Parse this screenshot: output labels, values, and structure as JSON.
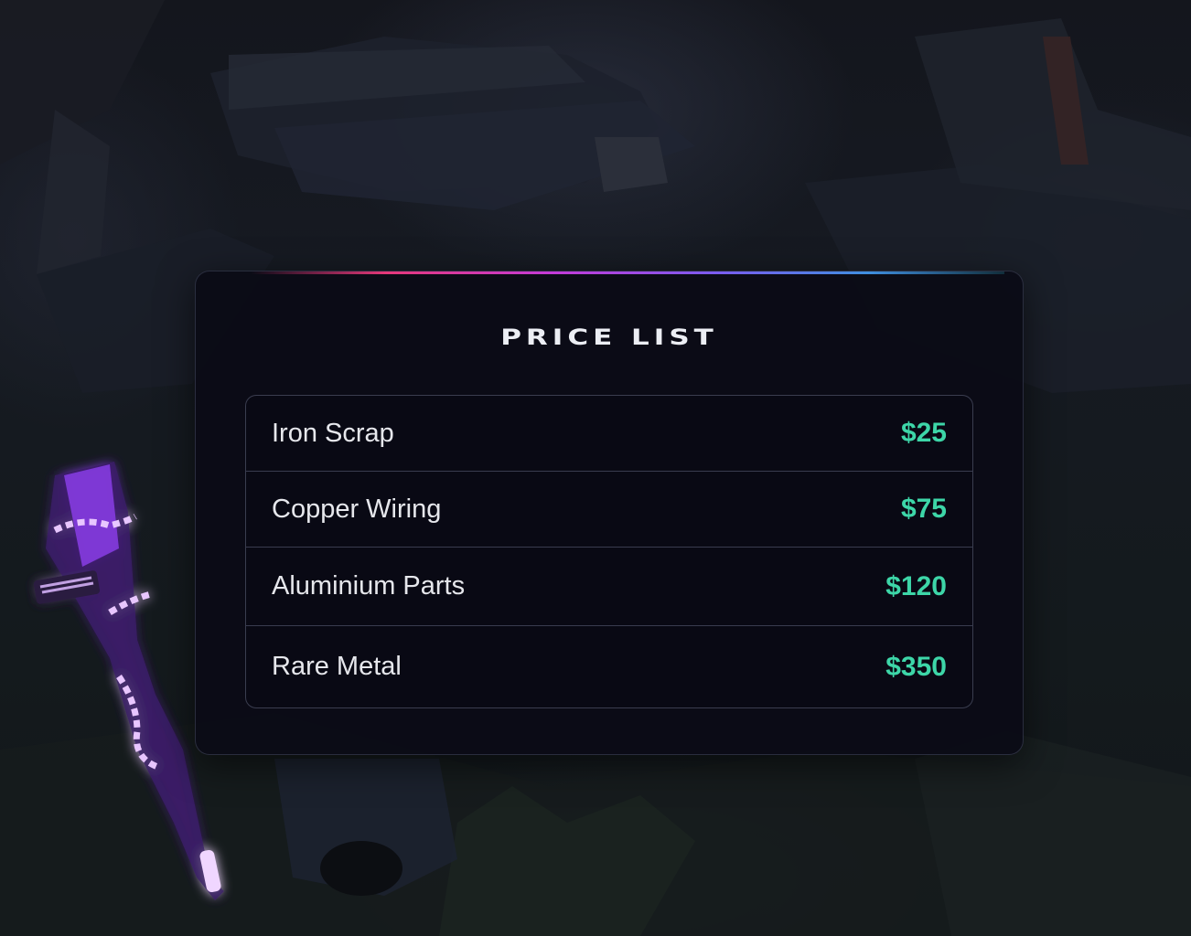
{
  "background": {
    "description_icon": "junkyard-scene"
  },
  "price_list": {
    "title": "PRICE LIST",
    "accent_colors": [
      "#e6387a",
      "#c43ad8",
      "#7a5cf0",
      "#3f8fe0"
    ],
    "price_color": "#3dd6a8",
    "items": [
      {
        "name": "Iron Scrap",
        "price": "$25"
      },
      {
        "name": "Copper Wiring",
        "price": "$75"
      },
      {
        "name": "Aluminium Parts",
        "price": "$120"
      },
      {
        "name": "Rare Metal",
        "price": "$350"
      }
    ]
  },
  "weapon": {
    "icon": "neon-rifle-icon"
  }
}
